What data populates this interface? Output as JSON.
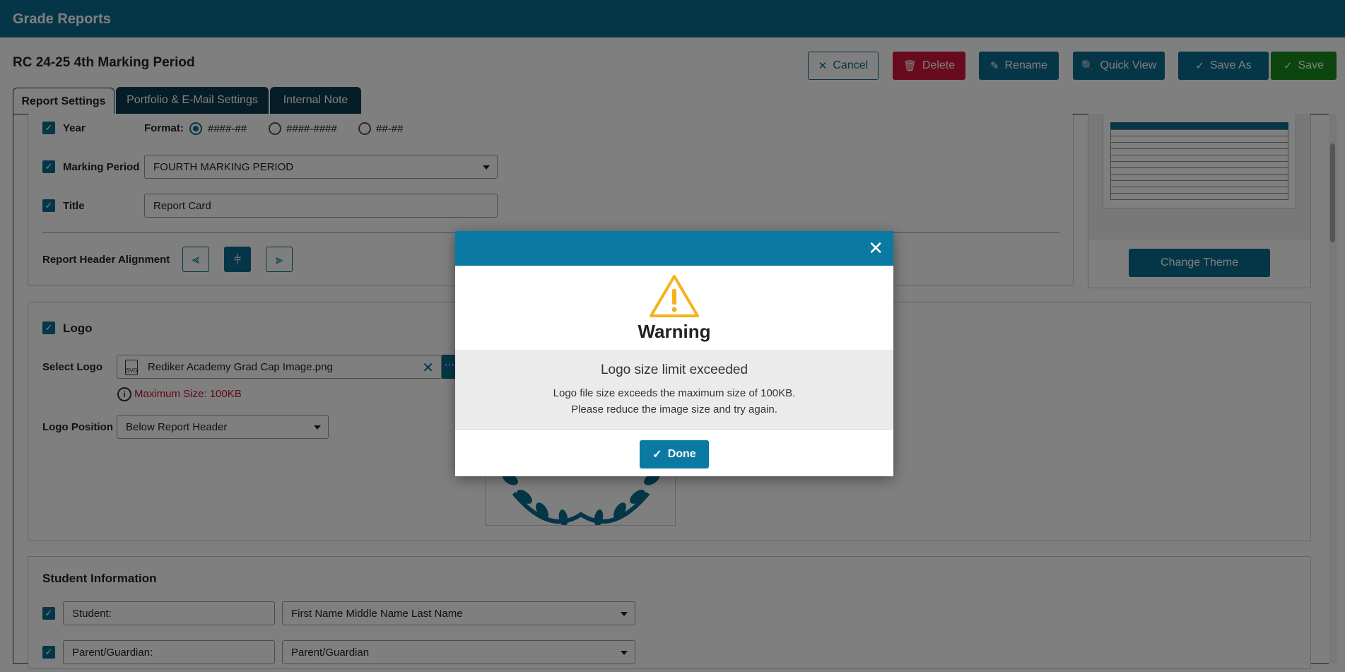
{
  "app": {
    "title": "Grade Reports"
  },
  "header": {
    "page_title": "RC 24-25 4th Marking Period"
  },
  "toolbar": {
    "cancel": "Cancel",
    "delete": "Delete",
    "rename": "Rename",
    "quick_view": "Quick View",
    "save_as": "Save As",
    "save": "Save"
  },
  "tabs": [
    {
      "label": "Report Settings",
      "active": true
    },
    {
      "label": "Portfolio & E-Mail Settings",
      "active": false
    },
    {
      "label": "Internal Note",
      "active": false
    }
  ],
  "header_settings": {
    "year": {
      "label": "Year",
      "checked": true
    },
    "format": {
      "label": "Format:",
      "options": [
        "####-##",
        "####-####",
        "##-##"
      ],
      "selected": "####-##"
    },
    "marking_period": {
      "label": "Marking Period",
      "checked": true,
      "value": "FOURTH MARKING PERIOD"
    },
    "title": {
      "label": "Title",
      "checked": true,
      "value": "Report Card"
    },
    "alignment": {
      "label": "Report Header Alignment",
      "selected": "center"
    }
  },
  "theme": {
    "change_label": "Change Theme"
  },
  "logo": {
    "label": "Logo",
    "checked": true,
    "select_label": "Select Logo",
    "file_name": "Rediker Academy Grad Cap Image.png",
    "max_size": "Maximum Size: 100KB",
    "position_label": "Logo Position",
    "position_value": "Below Report Header"
  },
  "student_info": {
    "heading": "Student Information",
    "rows": [
      {
        "label": "Student:",
        "value": "First Name Middle Name Last Name",
        "checked": true
      },
      {
        "label": "Parent/Guardian:",
        "value": "Parent/Guardian",
        "checked": true
      }
    ]
  },
  "dialog": {
    "title": "Warning",
    "message_heading": "Logo size limit exceeded",
    "message_line1": "Logo file size exceeds the maximum size of 100KB.",
    "message_line2": "Please reduce the image size and try again.",
    "done": "Done"
  },
  "colors": {
    "primary": "#0a6c8e",
    "dialog_header": "#0b7aa3",
    "delete": "#d3163e",
    "save": "#188a1a",
    "tab_dark": "#0d3b4e",
    "warning": "#f5b21b",
    "error_text": "#c8102e"
  }
}
